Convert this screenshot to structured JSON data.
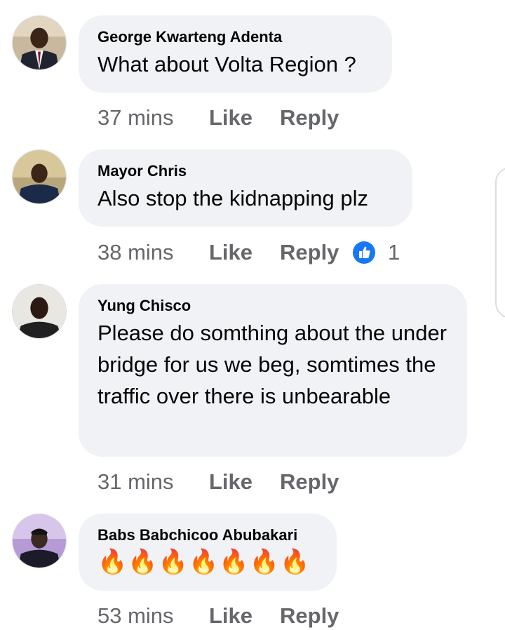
{
  "comments": [
    {
      "author": "George Kwarteng Adenta",
      "text": "What about Volta Region ?",
      "time": "37 mins",
      "like": "Like",
      "reply": "Reply"
    },
    {
      "author": "Mayor Chris",
      "text": "Also stop the kidnapping plz",
      "time": "38 mins",
      "like": "Like",
      "reply": "Reply",
      "reactions": {
        "icon": "like-reaction-icon",
        "count": "1",
        "color": "#1877f2"
      }
    },
    {
      "author": "Yung Chisco",
      "text": "Please do somthing about the under bridge for us we beg, somtimes the traffic over there is unbearable",
      "time": "31 mins",
      "like": "Like",
      "reply": "Reply"
    },
    {
      "author": "Babs Babchicoo Abubakari",
      "text": "🔥🔥🔥🔥🔥🔥🔥",
      "time": "53 mins",
      "like": "Like",
      "reply": "Reply"
    }
  ],
  "colors": {
    "bubble": "#f0f2f5",
    "secondary_text": "#65676b",
    "primary_text": "#050505",
    "like_blue": "#1877f2"
  }
}
